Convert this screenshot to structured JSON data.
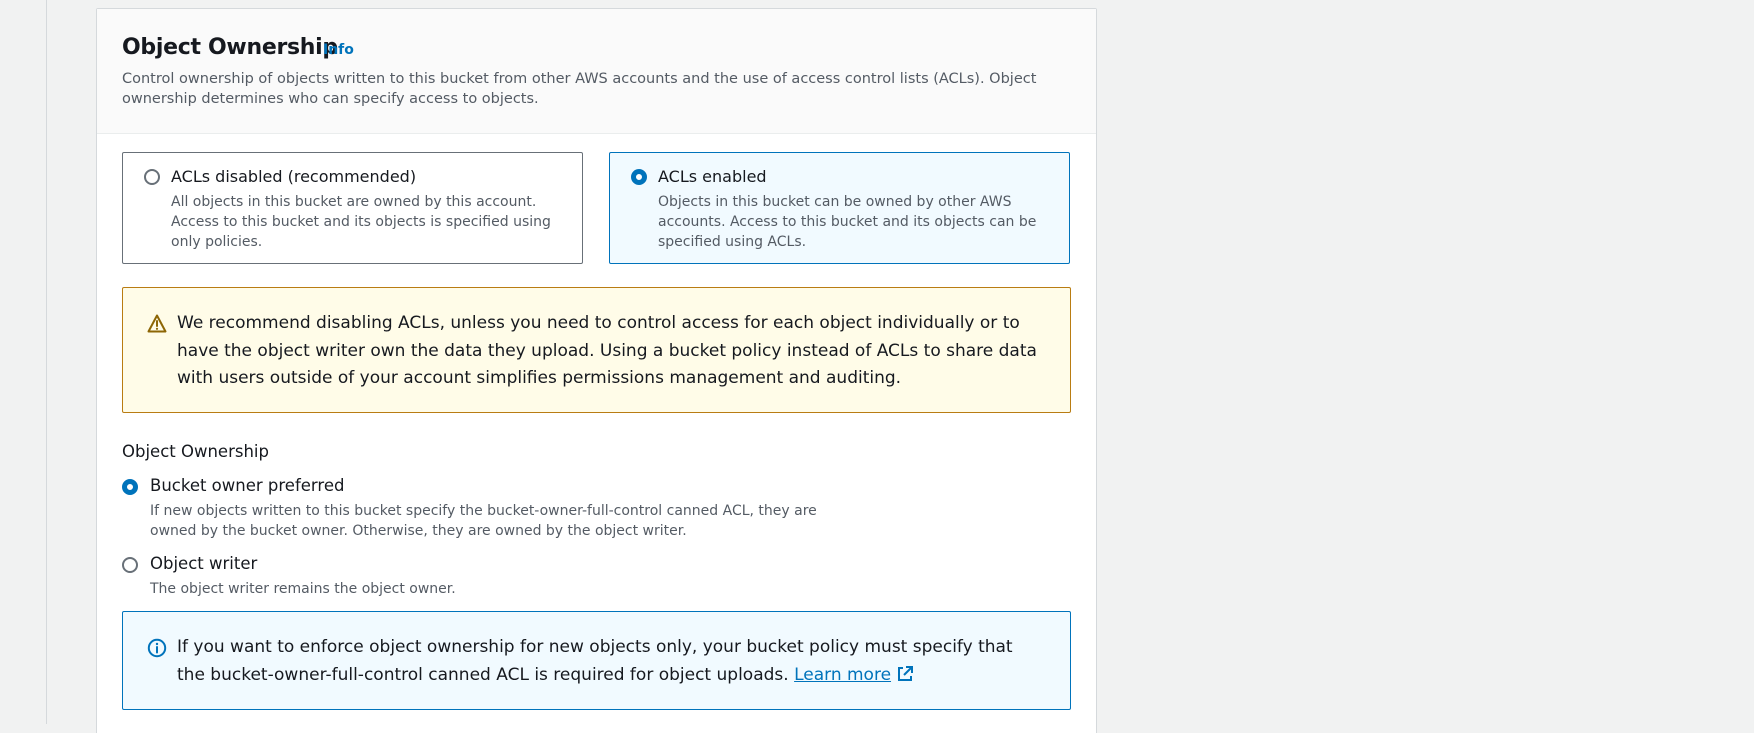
{
  "section": {
    "title": "Object Ownership",
    "info_link": "Info",
    "description": "Control ownership of objects written to this bucket from other AWS accounts and the use of access control lists (ACLs). Object ownership determines who can specify access to objects."
  },
  "acl_tiles": [
    {
      "label": "ACLs disabled (recommended)",
      "description": "All objects in this bucket are owned by this account. Access to this bucket and its objects is specified using only policies.",
      "selected": false
    },
    {
      "label": "ACLs enabled",
      "description": "Objects in this bucket can be owned by other AWS accounts. Access to this bucket and its objects can be specified using ACLs.",
      "selected": true
    }
  ],
  "warning": {
    "icon": "warning-icon",
    "text": "We recommend disabling ACLs, unless you need to control access for each object individually or to have the object writer own the data they upload. Using a bucket policy instead of ACLs to share data with users outside of your account simplifies permissions management and auditing."
  },
  "ownership": {
    "label": "Object Ownership",
    "options": [
      {
        "label": "Bucket owner preferred",
        "description": "If new objects written to this bucket specify the bucket-owner-full-control canned ACL, they are owned by the bucket owner. Otherwise, they are owned by the object writer.",
        "selected": true
      },
      {
        "label": "Object writer",
        "description": "The object writer remains the object owner.",
        "selected": false
      }
    ]
  },
  "info_alert": {
    "icon": "info-icon",
    "text": "If you want to enforce object ownership for new objects only, your bucket policy must specify that the bucket-owner-full-control canned ACL is required for object uploads.",
    "link_text": "Learn more",
    "link_icon": "external-link-icon"
  },
  "colors": {
    "accent": "#0073bb",
    "warning_border": "#b97c12",
    "warning_bg": "#fffce8",
    "info_bg": "#f1faff"
  }
}
